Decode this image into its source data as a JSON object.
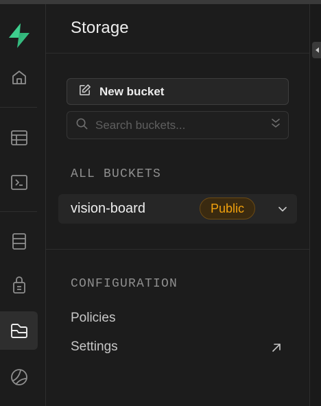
{
  "sidebar": {
    "items": [
      {
        "icon": "supabase-logo-icon"
      },
      {
        "icon": "home-icon"
      },
      {
        "icon": "table-editor-icon"
      },
      {
        "icon": "sql-editor-icon"
      },
      {
        "icon": "database-icon"
      },
      {
        "icon": "auth-lock-icon"
      },
      {
        "icon": "storage-icon",
        "active": true
      },
      {
        "icon": "realtime-icon"
      }
    ]
  },
  "header": {
    "title": "Storage"
  },
  "actions": {
    "new_bucket_label": "New bucket"
  },
  "search": {
    "placeholder": "Search buckets...",
    "value": ""
  },
  "buckets": {
    "section_label": "ALL BUCKETS",
    "items": [
      {
        "name": "vision-board",
        "badge": "Public"
      }
    ]
  },
  "configuration": {
    "section_label": "CONFIGURATION",
    "items": [
      {
        "label": "Policies"
      },
      {
        "label": "Settings",
        "external": true
      }
    ]
  },
  "colors": {
    "background": "#1c1c1c",
    "brand_green": "#3ecf8e",
    "public_badge": "#f1a10d",
    "active_item": "#2e2e2e"
  }
}
